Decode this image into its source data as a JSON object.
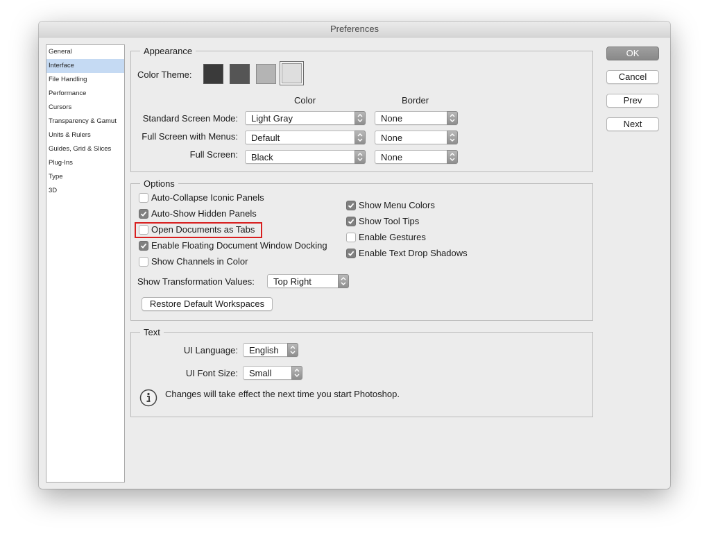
{
  "window": {
    "title": "Preferences"
  },
  "sidebar": {
    "items": [
      {
        "label": "General",
        "selected": false
      },
      {
        "label": "Interface",
        "selected": true
      },
      {
        "label": "File Handling",
        "selected": false
      },
      {
        "label": "Performance",
        "selected": false
      },
      {
        "label": "Cursors",
        "selected": false
      },
      {
        "label": "Transparency & Gamut",
        "selected": false
      },
      {
        "label": "Units & Rulers",
        "selected": false
      },
      {
        "label": "Guides, Grid & Slices",
        "selected": false
      },
      {
        "label": "Plug-Ins",
        "selected": false
      },
      {
        "label": "Type",
        "selected": false
      },
      {
        "label": "3D",
        "selected": false
      }
    ]
  },
  "appearance": {
    "legend": "Appearance",
    "color_theme_label": "Color Theme:",
    "themes": [
      {
        "name": "darkest",
        "color": "#3a3a3a"
      },
      {
        "name": "dark",
        "color": "#555555"
      },
      {
        "name": "light",
        "color": "#b4b4b4"
      },
      {
        "name": "lightest",
        "color": "#dedede",
        "selected": true
      }
    ],
    "color_header": "Color",
    "border_header": "Border",
    "rows": [
      {
        "label": "Standard Screen Mode:",
        "color": "Light Gray",
        "border": "None"
      },
      {
        "label": "Full Screen with Menus:",
        "color": "Default",
        "border": "None"
      },
      {
        "label": "Full Screen:",
        "color": "Black",
        "border": "None"
      }
    ]
  },
  "options": {
    "legend": "Options",
    "left_checks": [
      {
        "label": "Auto-Collapse Iconic Panels",
        "checked": false
      },
      {
        "label": "Auto-Show Hidden Panels",
        "checked": true
      },
      {
        "label": "Open Documents as Tabs",
        "checked": false,
        "highlighted": true
      },
      {
        "label": "Enable Floating Document Window Docking",
        "checked": true
      },
      {
        "label": "Show Channels in Color",
        "checked": false
      }
    ],
    "right_checks": [
      {
        "label": "Show Menu Colors",
        "checked": true
      },
      {
        "label": "Show Tool Tips",
        "checked": true
      },
      {
        "label": "Enable Gestures",
        "checked": false
      },
      {
        "label": "Enable Text Drop Shadows",
        "checked": true
      }
    ],
    "transform_label": "Show Transformation Values:",
    "transform_value": "Top Right",
    "restore_button": "Restore Default Workspaces"
  },
  "text": {
    "legend": "Text",
    "language_label": "UI Language:",
    "language_value": "English",
    "font_size_label": "UI Font Size:",
    "font_size_value": "Small",
    "notice": "Changes will take effect the next time you start Photoshop."
  },
  "buttons": {
    "ok": "OK",
    "cancel": "Cancel",
    "prev": "Prev",
    "next": "Next"
  },
  "colors": {
    "highlight": "#d81f1f",
    "selection": "#c5daf3",
    "checkbox_on": "#808080"
  }
}
